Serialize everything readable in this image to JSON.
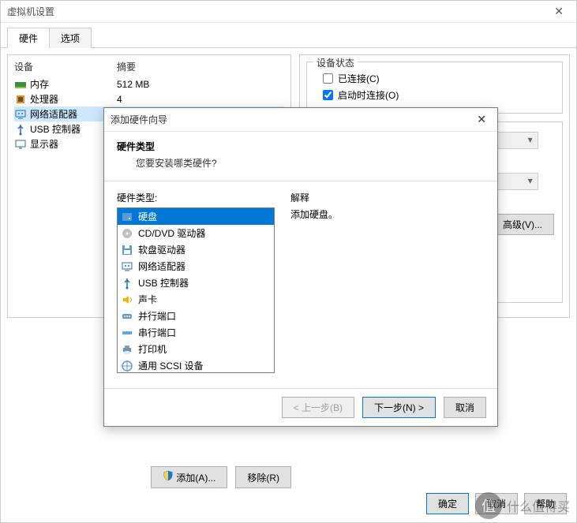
{
  "window": {
    "title": "虚拟机设置",
    "close": "✕"
  },
  "tabs": {
    "hardware": "硬件",
    "options": "选项"
  },
  "columns": {
    "device": "设备",
    "summary": "摘要"
  },
  "devices": [
    {
      "icon": "memory-icon",
      "name": "内存",
      "summary": "512 MB",
      "color": "#3a8f3a"
    },
    {
      "icon": "cpu-icon",
      "name": "处理器",
      "summary": "4",
      "color": "#2b6cb0"
    },
    {
      "icon": "network-icon",
      "name": "网络适配器",
      "summary": "",
      "color": "#2b6cb0",
      "selected": true
    },
    {
      "icon": "usb-icon",
      "name": "USB 控制器",
      "summary": "",
      "color": "#2b6cb0"
    },
    {
      "icon": "display-icon",
      "name": "显示器",
      "summary": "",
      "color": "#2b6cb0"
    }
  ],
  "status": {
    "legend": "设备状态",
    "connected": "已连接(C)",
    "connect_on_start": "启动时连接(O)"
  },
  "advanced_btn": "高级(V)...",
  "add_btn": "添加(A)...",
  "remove_btn": "移除(R)",
  "ok_btn": "确定",
  "cancel_btn": "取消",
  "help_btn": "帮助",
  "wizard": {
    "title": "添加硬件向导",
    "head1": "硬件类型",
    "head2": "您要安装哪类硬件?",
    "list_label": "硬件类型:",
    "expl_label": "解释",
    "expl_text": "添加硬盘。",
    "items": [
      {
        "icon": "disk-icon",
        "label": "硬盘",
        "selected": true
      },
      {
        "icon": "cd-icon",
        "label": "CD/DVD 驱动器"
      },
      {
        "icon": "floppy-icon",
        "label": "软盘驱动器"
      },
      {
        "icon": "network-icon",
        "label": "网络适配器"
      },
      {
        "icon": "usb-icon",
        "label": "USB 控制器"
      },
      {
        "icon": "sound-icon",
        "label": "声卡"
      },
      {
        "icon": "parallel-icon",
        "label": "并行端口"
      },
      {
        "icon": "serial-icon",
        "label": "串行端口"
      },
      {
        "icon": "printer-icon",
        "label": "打印机"
      },
      {
        "icon": "scsi-icon",
        "label": "通用 SCSI 设备"
      }
    ],
    "back": "< 上一步(B)",
    "next": "下一步(N) >",
    "cancel": "取消"
  },
  "watermark": "什么值得买"
}
